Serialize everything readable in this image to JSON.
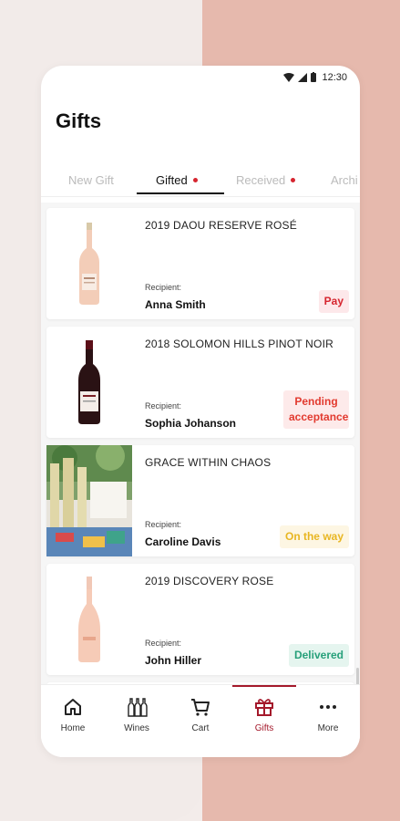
{
  "status_bar": {
    "time": "12:30"
  },
  "page": {
    "title": "Gifts"
  },
  "tabs": [
    {
      "label": "New Gift",
      "active": false,
      "dot": false
    },
    {
      "label": "Gifted",
      "active": true,
      "dot": true
    },
    {
      "label": "Received",
      "active": false,
      "dot": true
    },
    {
      "label": "Archi",
      "active": false,
      "dot": false
    }
  ],
  "gifts": [
    {
      "name": "2019 DAOU RESERVE ROSÉ",
      "recipient_label": "Recipient:",
      "recipient": "Anna Smith",
      "status": "Pay",
      "status_color": "#d6252f",
      "status_bg": "#fde8ea"
    },
    {
      "name": "2018 SOLOMON HILLS PINOT NOIR",
      "recipient_label": "Recipient:",
      "recipient": "Sophia  Johanson",
      "status": "Pending acceptance",
      "status_color": "#e23a2f",
      "status_bg": "#fdeaea"
    },
    {
      "name": "GRACE WITHIN CHAOS",
      "recipient_label": "Recipient:",
      "recipient": "Caroline Davis",
      "status": "On the way",
      "status_color": "#e8b622",
      "status_bg": "#fdf6e3"
    },
    {
      "name": "2019 DISCOVERY ROSE",
      "recipient_label": "Recipient:",
      "recipient": "John Hiller",
      "status": "Delivered",
      "status_color": "#27a07a",
      "status_bg": "#e5f5ef"
    }
  ],
  "nav": [
    {
      "label": "Home",
      "icon": "home-icon"
    },
    {
      "label": "Wines",
      "icon": "wines-icon"
    },
    {
      "label": "Cart",
      "icon": "cart-icon"
    },
    {
      "label": "Gifts",
      "icon": "gift-icon",
      "active": true
    },
    {
      "label": "More",
      "icon": "more-icon"
    }
  ]
}
